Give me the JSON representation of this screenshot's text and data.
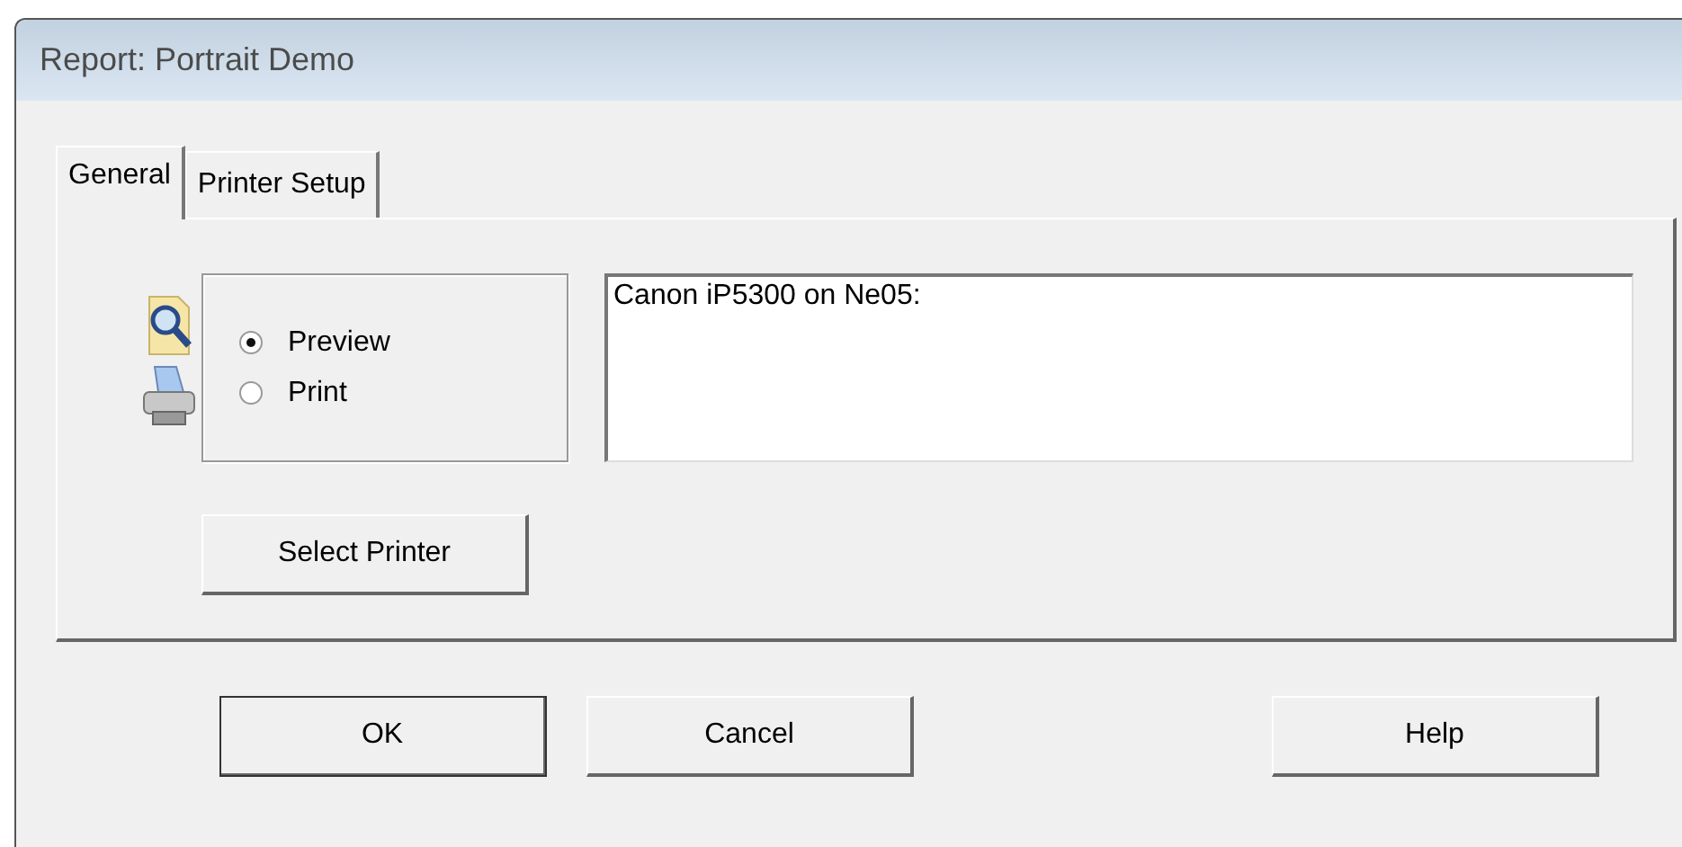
{
  "window": {
    "title": "Report: Portrait Demo"
  },
  "tabs": [
    {
      "label": "General",
      "selected": true
    },
    {
      "label": "Printer Setup",
      "selected": false
    }
  ],
  "output": {
    "options": [
      {
        "label": "Preview",
        "selected": true
      },
      {
        "label": "Print",
        "selected": false
      }
    ]
  },
  "printer": {
    "value": "Canon iP5300 on Ne05:"
  },
  "select_button": "Select Printer",
  "buttons": [
    {
      "label": "OK",
      "kind": "default"
    },
    {
      "label": "Cancel",
      "kind": "normal"
    },
    {
      "label": "Help",
      "kind": "normal"
    }
  ]
}
